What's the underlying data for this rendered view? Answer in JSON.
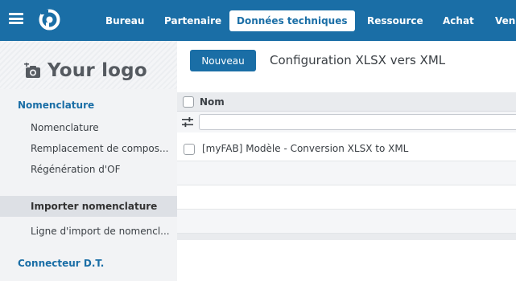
{
  "navbar": {
    "items": [
      {
        "label": "Bureau"
      },
      {
        "label": "Partenaire"
      },
      {
        "label": "Données techniques"
      },
      {
        "label": "Ressource"
      },
      {
        "label": "Achat"
      },
      {
        "label": "Ven"
      }
    ],
    "active_index": 2,
    "color": "#1a6ea6"
  },
  "logo": {
    "text": "Your logo",
    "icon": "camera-plus-icon"
  },
  "sidebar": {
    "section1": "Nomenclature",
    "items": [
      {
        "label": "Nomenclature"
      },
      {
        "label": "Remplacement de compos..."
      },
      {
        "label": "Régénération d'OF"
      },
      {
        "label": "Importer nomenclature"
      },
      {
        "label": "Ligne d'import de nomencl..."
      }
    ],
    "active_index": 3,
    "section2": "Connecteur D.T."
  },
  "main": {
    "new_button": "Nouveau",
    "title": "Configuration XLSX vers XML",
    "table": {
      "column": "Nom",
      "rows": [
        {
          "name": "[myFAB] Modèle - Conversion XLSX to XML"
        }
      ]
    }
  }
}
